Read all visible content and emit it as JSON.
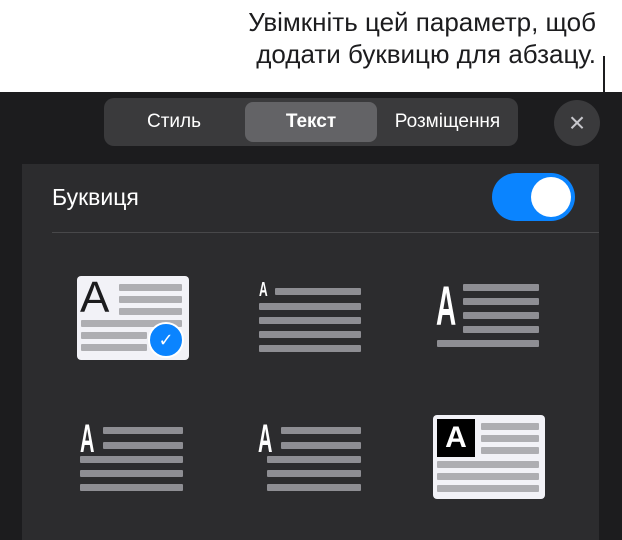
{
  "callout": {
    "line1": "Увімкніть цей параметр, щоб",
    "line2": "додати буквицю для абзацу."
  },
  "tabs": [
    {
      "label": "Стиль"
    },
    {
      "label": "Текст",
      "selected": true
    },
    {
      "label": "Розміщення"
    }
  ],
  "close_icon": "×",
  "dropcap": {
    "label": "Буквиця",
    "enabled": true
  },
  "styles": [
    {
      "glyph": "A",
      "selected": true,
      "check": "✓"
    },
    {
      "glyph": "A"
    },
    {
      "glyph": "A"
    },
    {
      "glyph": "A"
    },
    {
      "glyph": "A"
    },
    {
      "glyph": "A"
    }
  ],
  "colors": {
    "accent": "#0a84ff",
    "panel": "#1c1c1e"
  }
}
